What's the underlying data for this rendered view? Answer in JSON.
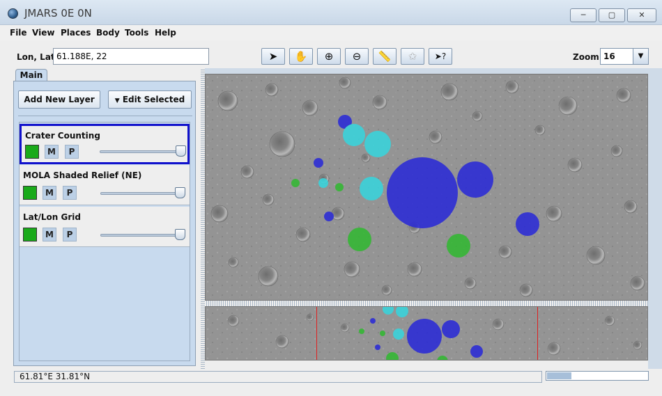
{
  "window": {
    "title": "JMARS 0E 0N",
    "min_label": "─",
    "max_label": "▢",
    "close_label": "✕"
  },
  "menu": [
    "File",
    "View",
    "Places",
    "Body",
    "Tools",
    "Help"
  ],
  "toolbar": {
    "lonlat_label": "Lon, Lat",
    "lonlat_value": "61.188E, 22",
    "tools": [
      {
        "name": "select-arrow-icon",
        "glyph": "➤"
      },
      {
        "name": "pan-hand-icon",
        "glyph": "✋"
      },
      {
        "name": "zoom-in-icon",
        "glyph": "⊕"
      },
      {
        "name": "zoom-out-icon",
        "glyph": "⊖"
      },
      {
        "name": "ruler-icon",
        "glyph": "📏"
      },
      {
        "name": "star-icon",
        "glyph": "✩"
      },
      {
        "name": "pointer-help-icon",
        "glyph": "➤?"
      }
    ],
    "zoom_label": "Zoom:",
    "zoom_value": "16"
  },
  "panel": {
    "tab": "Main",
    "add_layer": "Add New Layer",
    "edit_selected": "Edit Selected",
    "layers": [
      {
        "name": "Crater Counting",
        "opacity": 1.0,
        "selected": true
      },
      {
        "name": "MOLA Shaded Relief (NE)",
        "opacity": 1.0,
        "selected": false
      },
      {
        "name": "Lat/Lon Grid",
        "opacity": 1.0,
        "selected": false
      }
    ],
    "m_label": "M",
    "p_label": "P",
    "swatch_color": "#1aaa1a"
  },
  "status": {
    "coords": "61.81°E   31.81°N",
    "progress": 0.24
  },
  "colors": {
    "crater_blue": "#2b2bd6",
    "crater_cyan": "#38d4dc",
    "crater_green": "#33b833",
    "selected_border": "#1111cc"
  }
}
